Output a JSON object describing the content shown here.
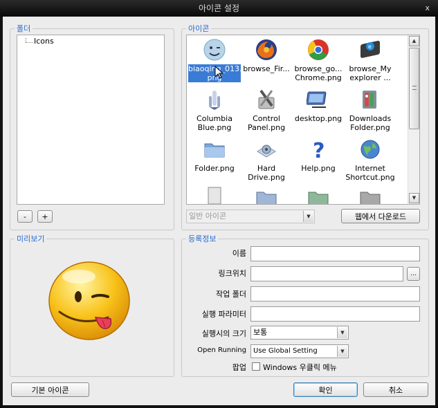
{
  "window": {
    "title": "아이콘 설정",
    "close_label": "x"
  },
  "folder_group": {
    "legend": "폴더",
    "tree_item": "Icons",
    "remove_label": "-",
    "add_label": "+"
  },
  "icon_group": {
    "legend": "아이콘",
    "items": [
      {
        "line1": "biaoqing_013.",
        "line2": "png",
        "icon": "smiley-face-icon"
      },
      {
        "line1": "browse_Fir...",
        "line2": "",
        "icon": "firefox-icon"
      },
      {
        "line1": "browse_go...",
        "line2": "Chrome.png",
        "icon": "chrome-icon"
      },
      {
        "line1": "browse_My",
        "line2": "explorer ...",
        "icon": "dark-explorer-icon"
      },
      {
        "line1": "Columbia",
        "line2": "Blue.png",
        "icon": "space-shuttle-icon"
      },
      {
        "line1": "Control",
        "line2": "Panel.png",
        "icon": "tools-icon"
      },
      {
        "line1": "desktop.png",
        "line2": "",
        "icon": "desktop-icon"
      },
      {
        "line1": "Downloads",
        "line2": "Folder.png",
        "icon": "downloads-folder-icon"
      },
      {
        "line1": "Folder.png",
        "line2": "",
        "icon": "folder-icon"
      },
      {
        "line1": "Hard",
        "line2": "Drive.png",
        "icon": "hard-drive-icon"
      },
      {
        "line1": "Help.png",
        "line2": "",
        "icon": "help-icon"
      },
      {
        "line1": "Internet",
        "line2": "Shortcut.png",
        "icon": "globe-icon"
      }
    ],
    "category_value": "일반 아이콘",
    "download_label": "웹에서 다운로드"
  },
  "preview_group": {
    "legend": "미리보기"
  },
  "info_group": {
    "legend": "등록정보",
    "name_label": "이름",
    "link_label": "링크위치",
    "browse_label": "...",
    "workdir_label": "작업 폴더",
    "params_label": "실행 파라미터",
    "size_label": "실행시의 크기",
    "size_value": "보통",
    "open_running_label": "Open Running",
    "open_running_value": "Use Global Setting",
    "popup_label": "팝업",
    "popup_checkbox_label": "Windows 우클릭 메뉴"
  },
  "footer": {
    "default_icon_label": "기본 아이콘",
    "ok_label": "확인",
    "cancel_label": "취소"
  },
  "colors": {
    "accent": "#2a6bd1",
    "selection": "#3a7bd5"
  }
}
